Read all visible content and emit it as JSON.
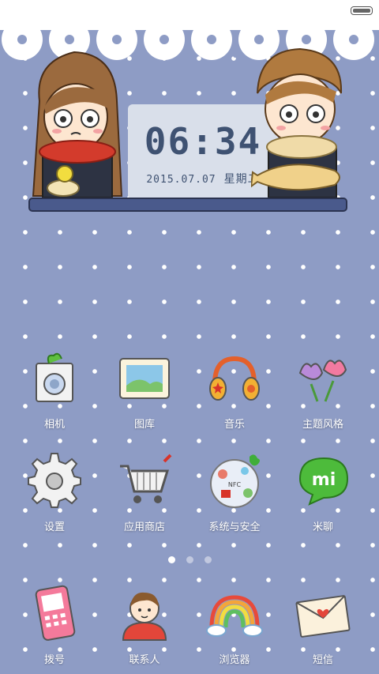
{
  "status_bar": {
    "battery_icon": "battery-icon"
  },
  "clock_widget": {
    "time": "06:34",
    "date": "2015.07.07",
    "weekday": "星期二"
  },
  "page_indicator": {
    "pages": 3,
    "active_index": 0
  },
  "apps": [
    {
      "label": "相机",
      "icon": "camera-icon"
    },
    {
      "label": "图库",
      "icon": "gallery-icon"
    },
    {
      "label": "音乐",
      "icon": "headphones-icon"
    },
    {
      "label": "主题风格",
      "icon": "tulip-flowers-icon"
    },
    {
      "label": "设置",
      "icon": "gear-icon"
    },
    {
      "label": "应用商店",
      "icon": "shopping-cart-icon"
    },
    {
      "label": "系统与安全",
      "icon": "system-security-icon"
    },
    {
      "label": "米聊",
      "icon": "mi-chat-bubble-icon"
    }
  ],
  "dock": [
    {
      "label": "拨号",
      "icon": "phone-handset-icon"
    },
    {
      "label": "联系人",
      "icon": "contact-person-icon"
    },
    {
      "label": "浏览器",
      "icon": "rainbow-icon"
    },
    {
      "label": "短信",
      "icon": "envelope-icon"
    }
  ],
  "colors": {
    "wallpaper": "#8e9cc5",
    "clock_text": "#3f5272",
    "shelf": "#4a5a8c"
  }
}
